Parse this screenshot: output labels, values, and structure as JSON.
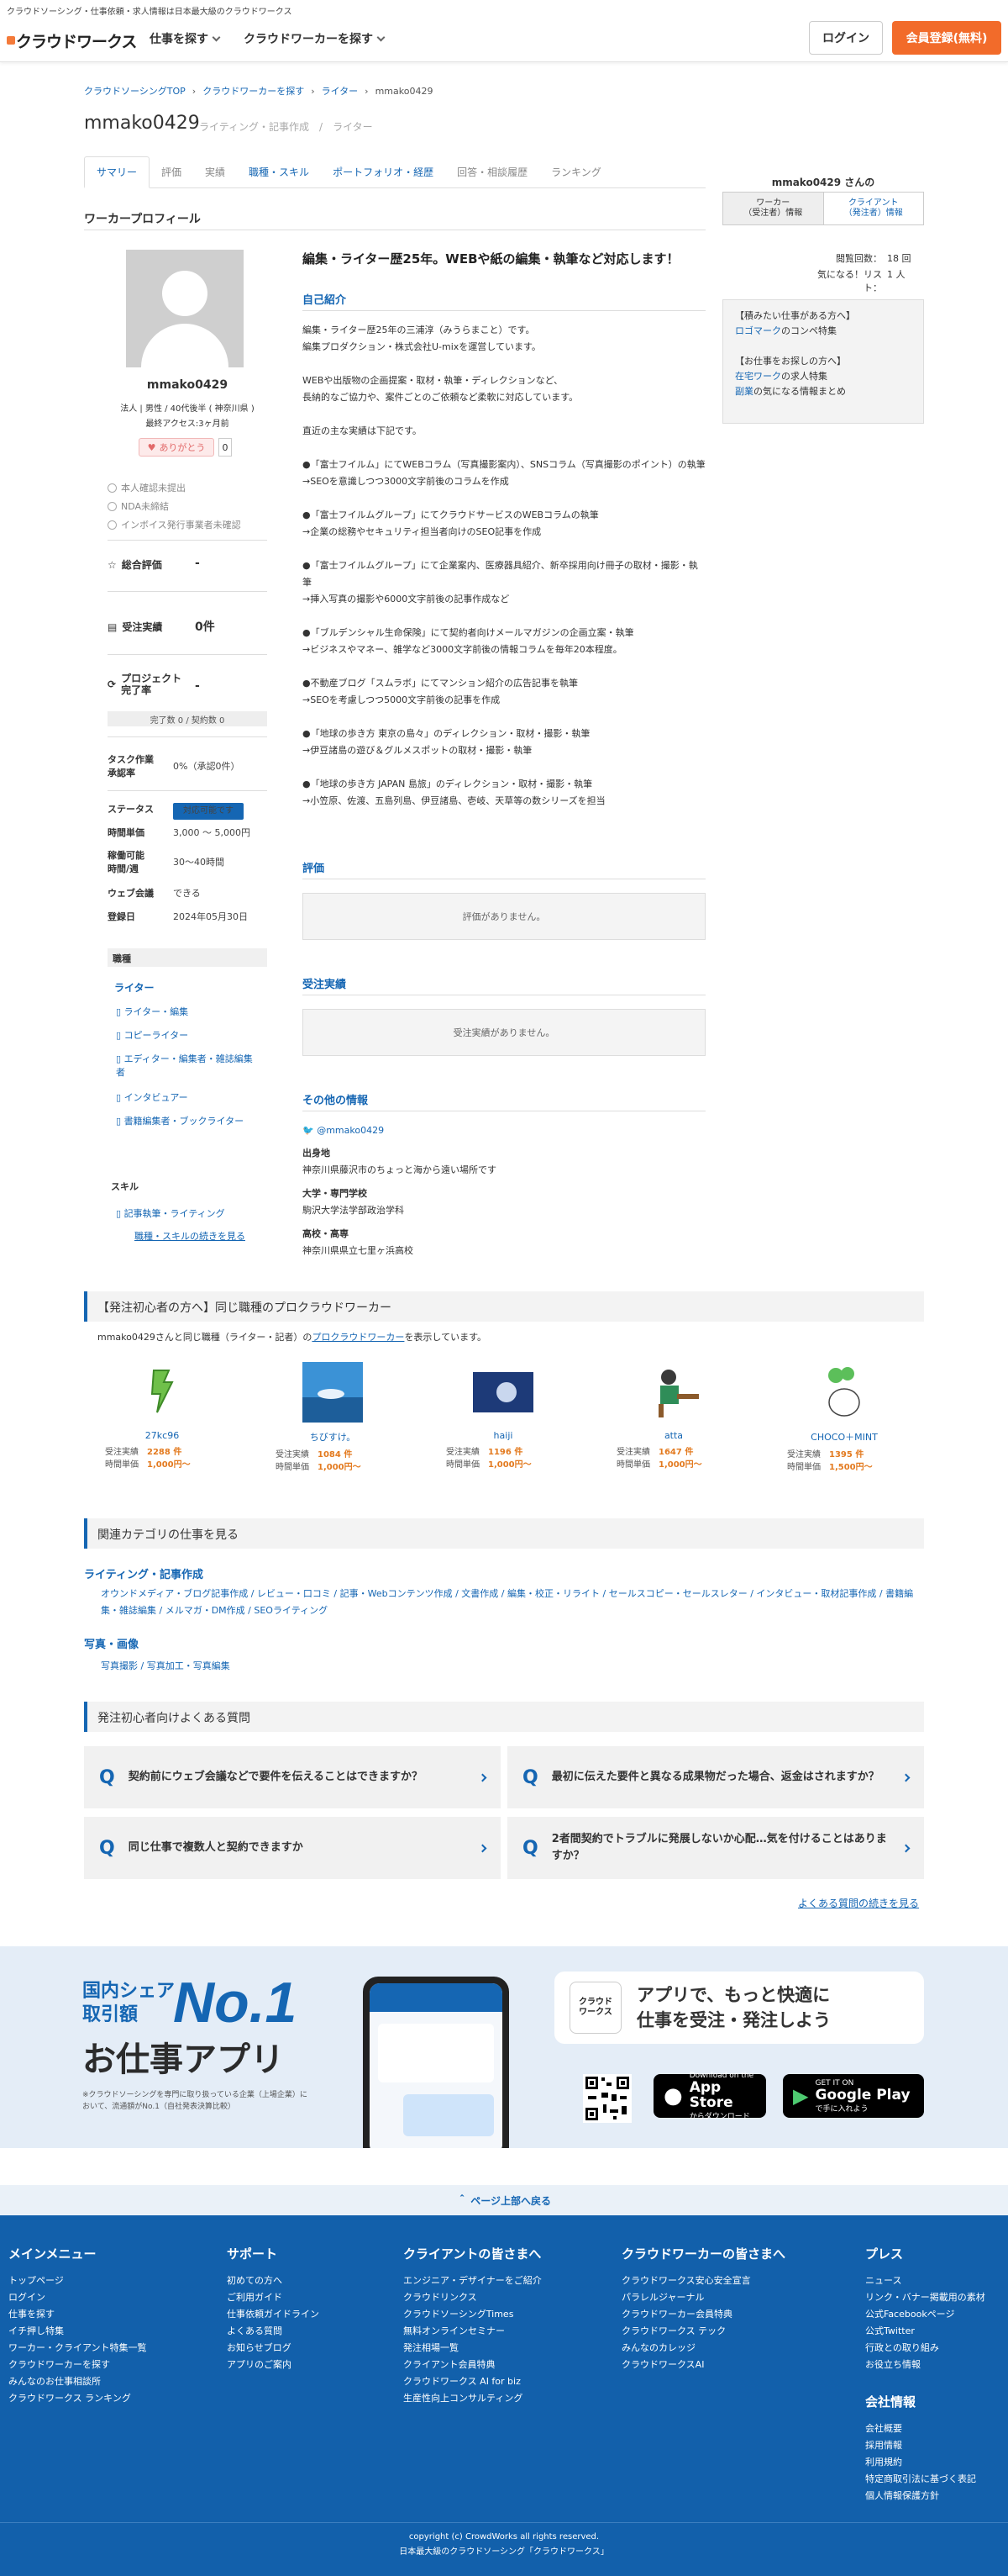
{
  "header": {
    "tagline": "クラウドソーシング・仕事依頼・求人情報は日本最大級のクラウドワークス",
    "logo_text": "クラウドワークス",
    "nav": [
      "仕事を探す",
      "クラウドワーカーを探す"
    ],
    "login_label": "ログイン",
    "register_label": "会員登録(無料)"
  },
  "breadcrumb": [
    "クラウドソーシングTOP",
    "クラウドワーカーを探す",
    "ライター",
    "mmako0429"
  ],
  "profile_header": {
    "username": "mmako0429",
    "subtitle": "ライティング・記事作成　/　ライター"
  },
  "tabs": [
    {
      "label": "サマリー",
      "state": "active"
    },
    {
      "label": "評価",
      "state": "muted"
    },
    {
      "label": "実績",
      "state": "muted"
    },
    {
      "label": "職種・スキル",
      "state": "link"
    },
    {
      "label": "ポートフォリオ・経歴",
      "state": "link"
    },
    {
      "label": "回答・相談履歴",
      "state": "muted"
    },
    {
      "label": "ランキング",
      "state": "muted"
    }
  ],
  "section_title": "ワーカープロフィール",
  "left": {
    "name": "mmako0429",
    "meta": "法人 | 男性 / 40代後半 ( 神奈川県 )",
    "last_access": "最終アクセス:3ヶ月前",
    "like_label": "ありがとう",
    "like_count": "0",
    "checks": [
      "本人確認未提出",
      "NDA未締結",
      "インボイス発行事業者未確認"
    ],
    "overall_label": "総合評価",
    "overall_value": "-",
    "orders_label": "受注実績",
    "orders_value": "0件",
    "project_label": "プロジェクト\n完了率",
    "project_value": "-",
    "project_sub": "完了数 0 / 契約数 0",
    "task_label": "タスク作業\n承認率",
    "task_value": "0%（承認0件）",
    "status_label": "ステータス",
    "status_value": "対応可能です",
    "rate_label": "時間単価",
    "rate_value": "3,000 〜 5,000円",
    "hours_label": "稼働可能\n時間/週",
    "hours_value": "30〜40時間",
    "meeting_label": "ウェブ会議",
    "meeting_value": "できる",
    "registered_label": "登録日",
    "registered_value": "2024年05月30日",
    "job_type_heading": "職種",
    "job_category": "ライター",
    "jobs": [
      "ライター・編集",
      "コピーライター",
      "エディター・編集者・雑誌編集者",
      "インタビュアー",
      "書籍編集者・ブックライター"
    ],
    "skill_heading": "スキル",
    "skills": [
      "記事執筆・ライティング"
    ],
    "skills_more": "職種・スキルの続きを見る"
  },
  "center": {
    "headline": "編集・ライター歴25年。WEBや紙の編集・執筆など対応します！",
    "intro_heading": "自己紹介",
    "intro_text": "編集・ライター歴25年の三浦淳（みうらまこと）です。\n編集プロダクション・株式会社U-mixを運営しています。\n\nWEBや出版物の企画提案・取材・執筆・ディレクションなど、\n長納的なご協力や、案件ごとのご依頼など柔軟に対応しています。\n\n直近の主な実績は下記です。\n\n●「富士フイルム」にてWEBコラム（写真撮影案内）、SNSコラム（写真撮影のポイント）の執筆\n→SEOを意識しつつ3000文字前後のコラムを作成\n\n●「富士フイルムグループ」にてクラウドサービスのWEBコラムの執筆\n→企業の総務やセキュリティ担当者向けのSEO記事を作成\n\n●「富士フイルムグループ」にて企業案内、医療器具紹介、新卒採用向け冊子の取材・撮影・執筆\n→挿入写真の撮影や6000文字前後の記事作成など\n\n●「ブルデンシャル生命保険」にて契約者向けメールマガジンの企画立案・執筆\n→ビジネスやマネー、雑学など3000文字前後の情報コラムを毎年20本程度。\n\n●不動産ブログ「スムラボ」にてマンション紹介の広告記事を執筆\n→SEOを考慮しつつ5000文字前後の記事を作成\n\n●「地球の歩き方 東京の島々」のディレクション・取材・撮影・執筆\n→伊豆諸島の遊び＆グルメスポットの取材・撮影・執筆\n\n●「地球の歩き方 JAPAN 島旅」のディレクション・取材・撮影・執筆\n→小笠原、佐渡、五島列島、伊豆諸島、壱岐、天草等の数シリーズを担当",
    "review_heading": "評価",
    "review_empty": "評価がありません。",
    "orders_heading": "受注実績",
    "orders_empty": "受注実績がありません。",
    "other_heading": "その他の情報",
    "twitter": "@mmako0429",
    "birth_label": "出身地",
    "birth_value": "神奈川県藤沢市のちょっと海から遠い場所です",
    "univ_label": "大学・専門学校",
    "univ_value": "駒沢大学法学部政治学科",
    "hs_label": "高校・高専",
    "hs_value": "神奈川県県立七里ヶ浜高校"
  },
  "right": {
    "name": "mmako0429 さんの",
    "tab_worker": "ワーカー\n（受注者）情報",
    "tab_client": "クライアント\n（発注者）情報",
    "views_label": "閲覧回数：",
    "views_value": "18 回",
    "fav_label": "気になる！リスト：",
    "fav_value": "1 人",
    "box_line1": "【積みたい仕事がある方へ】",
    "box_link1": "ロゴマーク",
    "box_text1": "のコンペ特集",
    "box_line2": "【お仕事をお探しの方へ】",
    "box_link2": "在宅ワーク",
    "box_text2": "の求人特集",
    "box_link3": "副業",
    "box_text3": "の気になる情報まとめ"
  },
  "similar": {
    "heading": "【発注初心者の方へ】同じ職種のプロクラウドワーカー",
    "desc_pre": "mmako0429さんと同じ職種（ライター・記者）の",
    "desc_link": "プロクラウドワーカー",
    "desc_post": "を表示しています。",
    "workers": [
      {
        "name": "27kc96",
        "orders": "2288 件",
        "rate": "1,000円〜"
      },
      {
        "name": "ちびすけ。",
        "orders": "1084 件",
        "rate": "1,000円〜"
      },
      {
        "name": "haiji",
        "orders": "1196 件",
        "rate": "1,000円〜"
      },
      {
        "name": "atta",
        "orders": "1647 件",
        "rate": "1,000円〜"
      },
      {
        "name": "CHOCO＋MINT",
        "orders": "1395 件",
        "rate": "1,500円〜"
      }
    ],
    "orders_label": "受注実績",
    "rate_label": "時間単価"
  },
  "related": {
    "heading": "関連カテゴリの仕事を見る",
    "cat1": "ライティング・記事作成",
    "cat1_links": "オウンドメディア・ブログ記事作成 / レビュー・口コミ / 記事・Webコンテンツ作成 / 文書作成 / 編集・校正・リライト / セールスコピー・セールスレター / インタビュー・取材記事作成 / 書籍編集・雑誌編集 / メルマガ・DM作成 / SEOライティング",
    "cat2": "写真・画像",
    "cat2_links": "写真撮影 / 写真加工・写真編集"
  },
  "faq": {
    "heading": "発注初心者向けよくある質問",
    "items": [
      "契約前にウェブ会議などで要件を伝えることはできますか？",
      "最初に伝えた要件と異なる成果物だった場合、返金はされますか？",
      "同じ仕事で複数人と契約できますか",
      "2者間契約でトラブルに発展しないか心配…気を付けることはありますか？"
    ],
    "q_mark": "Q",
    "more": "よくある質問の続きを見る"
  },
  "promo": {
    "share": "国内シェア",
    "amount": "取引額",
    "no1": "No.1",
    "app": "お仕事アプリ",
    "note": "※クラウドソーシングを専門に取り扱っている企業（上場企業）において、流通額がNo.1（自社発表決算比較）",
    "bubble": "アプリで、もっと快適に\n仕事を受注・発注しよう",
    "cw_logo": "クラウド\nワークス",
    "appstore_sm": "Download on the",
    "appstore": "App Store",
    "appstore_sub": "からダウンロード",
    "gplay_sm": "GET IT ON",
    "gplay": "Google Play",
    "gplay_sub": "で手に入れよう"
  },
  "to_top": "ページ上部へ戻る",
  "footer": {
    "cols": [
      {
        "heading": "メインメニュー",
        "items": [
          "トップページ",
          "ログイン",
          "仕事を探す",
          "イチ押し特集",
          "ワーカー・クライアント特集一覧",
          "クラウドワーカーを探す",
          "みんなのお仕事相談所",
          "クラウドワークス ランキング"
        ]
      },
      {
        "heading": "サポート",
        "items": [
          "初めての方へ",
          "ご利用ガイド",
          "仕事依頼ガイドライン",
          "よくある質問",
          "お知らせブログ",
          "アプリのご案内"
        ]
      },
      {
        "heading": "クライアントの皆さまへ",
        "items": [
          "エンジニア・デザイナーをご紹介",
          "クラウドリンクス",
          "クラウドソーシングTimes",
          "無料オンラインセミナー",
          "発注相場一覧",
          "クライアント会員特典",
          "クラウドワークス AI for biz",
          "生産性向上コンサルティング"
        ]
      },
      {
        "heading": "クラウドワーカーの皆さまへ",
        "items": [
          "クラウドワークス安心安全宣言",
          "パラレルジャーナル",
          "クラウドワーカー会員特典",
          "クラウドワークス テック",
          "みんなのカレッジ",
          "クラウドワークスAI"
        ]
      },
      {
        "heading": "プレス",
        "items": [
          "ニュース",
          "リンク・バナー掲載用の素材",
          "公式Facebookページ",
          "公式Twitter",
          "行政との取り組み",
          "お役立ち情報"
        ]
      }
    ],
    "company_heading": "会社情報",
    "company_items": [
      "会社概要",
      "採用情報",
      "利用規約",
      "特定商取引法に基づく表記",
      "個人情報保護方針"
    ],
    "copyright": "copyright (c) CrowdWorks all rights reserved.",
    "tagline": "日本最大級のクラウドソーシング「クラウドワークス」"
  },
  "colors": {
    "accent": "#1566b3",
    "brand_orange": "#f26b2a",
    "footer_bg": "#1260ab"
  }
}
